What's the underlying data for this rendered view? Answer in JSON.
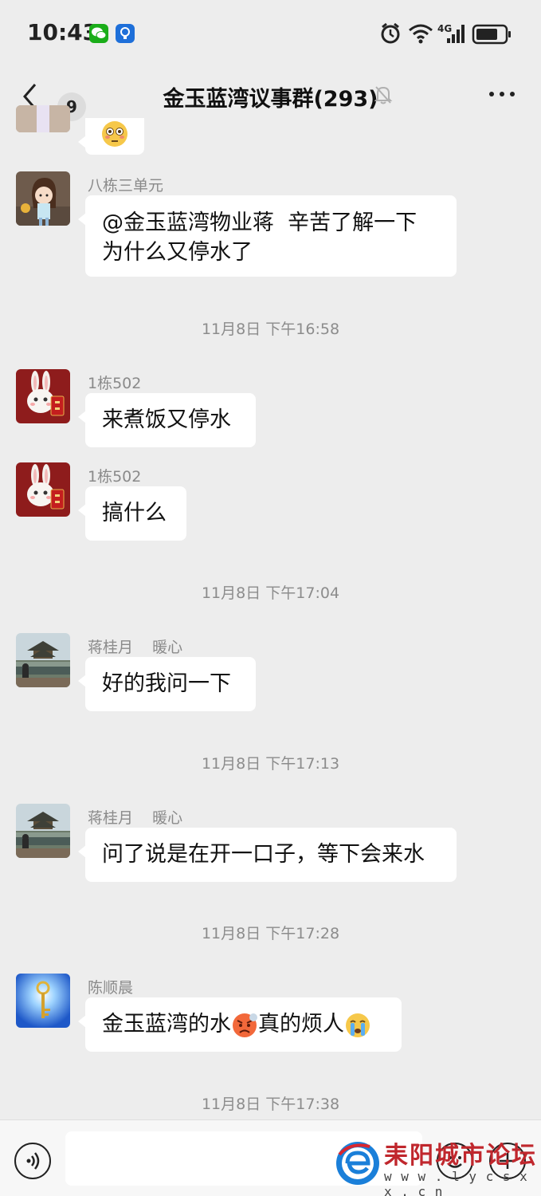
{
  "status_bar": {
    "time": "10:43",
    "network": "4G",
    "app_icons": [
      "wechat-icon",
      "lightbulb-icon"
    ],
    "right_icons": [
      "alarm-icon",
      "wifi-icon",
      "signal-icon",
      "battery-icon"
    ]
  },
  "header": {
    "unread_count": "9",
    "title": "金玉蓝湾议事群(293)",
    "icons": [
      "back-chevron-icon",
      "muted-bell-icon",
      "more-dots-icon"
    ]
  },
  "messages": [
    {
      "type": "message",
      "sender": "",
      "avatar": "avatar-partial",
      "content": [
        {
          "emoji": "flushed-face-emoji"
        }
      ]
    },
    {
      "type": "message",
      "sender": "八栋三单元",
      "avatar": "avatar-girl",
      "content": [
        {
          "text": "@金玉蓝湾物业蒋  辛苦了解一下"
        },
        {
          "text": "为什么又停水了"
        }
      ]
    },
    {
      "type": "time",
      "text": "11月8日 下午16:58"
    },
    {
      "type": "message",
      "sender": "1栋502",
      "avatar": "avatar-rabbit",
      "content": [
        {
          "text": "来煮饭又停水"
        }
      ]
    },
    {
      "type": "message",
      "sender": "1栋502",
      "avatar": "avatar-rabbit",
      "content": [
        {
          "text": "搞什么"
        }
      ]
    },
    {
      "type": "time",
      "text": "11月8日 下午17:04"
    },
    {
      "type": "message",
      "sender": "蒋桂月    暖心",
      "avatar": "avatar-pavilion",
      "content": [
        {
          "text": "好的我问一下"
        }
      ]
    },
    {
      "type": "time",
      "text": "11月8日 下午17:13"
    },
    {
      "type": "message",
      "sender": "蒋桂月    暖心",
      "avatar": "avatar-pavilion",
      "content": [
        {
          "text": "问了说是在开一口子，等下会来水"
        }
      ]
    },
    {
      "type": "time",
      "text": "11月8日 下午17:28"
    },
    {
      "type": "message",
      "sender": "陈顺晨",
      "avatar": "avatar-key",
      "content": [
        {
          "text": "金玉蓝湾的水"
        },
        {
          "emoji": "angry-face-emoji"
        },
        {
          "text": "真的烦人"
        },
        {
          "emoji": "crying-face-emoji"
        }
      ]
    },
    {
      "type": "time",
      "text": "11月8日 下午17:38"
    }
  ],
  "input_bar": {
    "icons": [
      "voice-icon",
      "emoji-icon",
      "plus-icon"
    ],
    "input_value": ""
  },
  "watermark": {
    "text": "耒阳城市论坛",
    "url": "w w w . l y c s x x . c n"
  },
  "colors": {
    "background": "#ededed",
    "bubble": "#ffffff",
    "rabbit_bg": "#8e1c1c",
    "wechat_green": "#1aad19",
    "watermark_red": "#c0272d"
  }
}
